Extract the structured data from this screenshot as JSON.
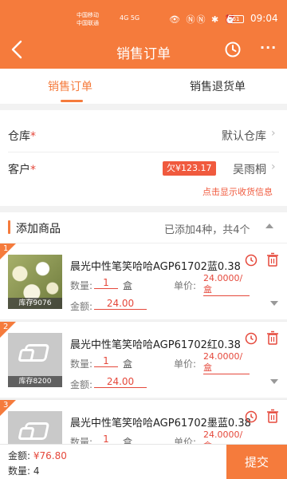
{
  "status_bar": {
    "carrier1": "中国移动",
    "carrier2": "中国联通",
    "network": "4G 5G",
    "icons": "👁 ⓃⓃ ✱ ⏰",
    "battery": "61",
    "time": "09:04"
  },
  "app_bar": {
    "title": "销售订单",
    "more": "···"
  },
  "tabs": [
    "销售订单",
    "销售退货单"
  ],
  "form": {
    "warehouse_label": "仓库",
    "warehouse_value": "默认仓库",
    "customer_label": "客户",
    "owed_badge": "欠¥123.17",
    "customer_value": "吴雨桐",
    "show_address_link": "点击显示收货信息",
    "required_mark": "*"
  },
  "products_section": {
    "title": "添加商品",
    "summary": "已添加4种，共4个"
  },
  "item_labels": {
    "qty": "数量:",
    "unit_price": "单价:",
    "amount": "金额:"
  },
  "items": [
    {
      "index": "1",
      "name": "晨光中性笔笑哈哈AGP61702蓝0.38",
      "stock": "库存9076",
      "qty": "1",
      "unit": "盒",
      "price": "24.0000/盒",
      "amount": "24.00"
    },
    {
      "index": "2",
      "name": "晨光中性笔笑哈哈AGP61702红0.38",
      "stock": "库存8200",
      "qty": "1",
      "unit": "盒",
      "price": "24.0000/盒",
      "amount": "24.00"
    },
    {
      "index": "3",
      "name": "晨光中性笔笑哈哈AGP61702墨蓝0.38",
      "stock": "",
      "qty": "1",
      "unit": "盒",
      "price": "24.0000/盒",
      "amount": ""
    }
  ],
  "footer": {
    "amount_label": "金额:",
    "amount_value": "¥76.80",
    "qty_label": "数量:",
    "qty_value": "4",
    "submit_label": "提交"
  },
  "colors": {
    "accent": "#f57b3c",
    "red": "#e5483b"
  }
}
